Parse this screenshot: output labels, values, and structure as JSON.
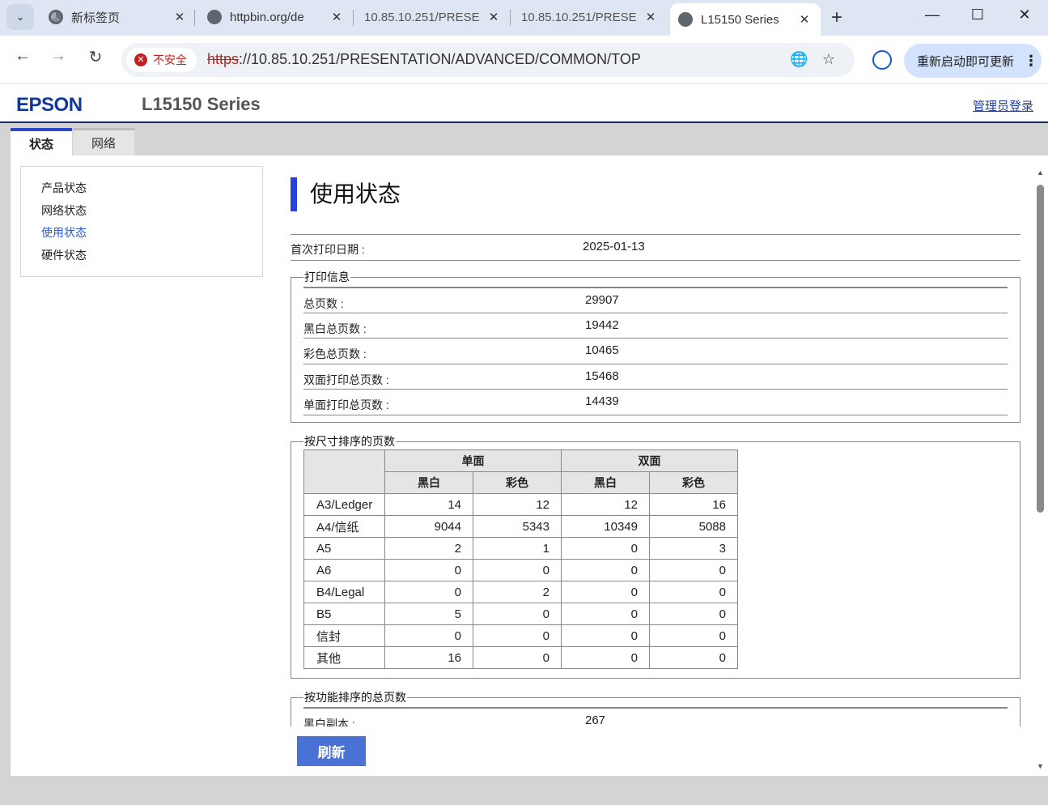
{
  "browser": {
    "tabs": [
      {
        "title": "新标签页",
        "icon": "chrome-icon"
      },
      {
        "title": "httpbin.org/de",
        "icon": "globe-icon"
      },
      {
        "title": "10.85.10.251/PRESE",
        "icon": "none"
      },
      {
        "title": "10.85.10.251/PRESE",
        "icon": "none"
      },
      {
        "title": "L15150 Series",
        "icon": "globe-icon",
        "active": true
      }
    ],
    "security_label": "不安全",
    "url_scheme": "https",
    "url_rest": "://10.85.10.251/PRESENTATION/ADVANCED/COMMON/TOP",
    "update_button": "重新启动即可更新"
  },
  "header": {
    "logo": "EPSON",
    "model": "L15150 Series",
    "admin_link": "管理员登录"
  },
  "tabs": [
    {
      "label": "状态",
      "active": true
    },
    {
      "label": "网络",
      "active": false
    }
  ],
  "sidebar": {
    "items": [
      {
        "label": "产品状态"
      },
      {
        "label": "网络状态"
      },
      {
        "label": "使用状态",
        "current": true
      },
      {
        "label": "硬件状态"
      }
    ]
  },
  "main": {
    "title": "使用状态",
    "first_print": {
      "label": "首次打印日期 :",
      "value": "2025-01-13"
    },
    "print_info": {
      "legend": "打印信息",
      "rows": [
        {
          "label": "总页数 :",
          "value": "29907"
        },
        {
          "label": "黑白总页数 :",
          "value": "19442"
        },
        {
          "label": "彩色总页数 :",
          "value": "10465"
        },
        {
          "label": "双面打印总页数 :",
          "value": "15468"
        },
        {
          "label": "单面打印总页数 :",
          "value": "14439"
        }
      ]
    },
    "by_size": {
      "legend": "按尺寸排序的页数",
      "group_headers": [
        "单面",
        "双面"
      ],
      "sub_headers": [
        "黑白",
        "彩色",
        "黑白",
        "彩色"
      ],
      "rows": [
        {
          "size": "A3/Ledger",
          "values": [
            "14",
            "12",
            "12",
            "16"
          ]
        },
        {
          "size": "A4/信纸",
          "values": [
            "9044",
            "5343",
            "10349",
            "5088"
          ]
        },
        {
          "size": "A5",
          "values": [
            "2",
            "1",
            "0",
            "3"
          ]
        },
        {
          "size": "A6",
          "values": [
            "0",
            "0",
            "0",
            "0"
          ]
        },
        {
          "size": "B4/Legal",
          "values": [
            "0",
            "2",
            "0",
            "0"
          ]
        },
        {
          "size": "B5",
          "values": [
            "5",
            "0",
            "0",
            "0"
          ]
        },
        {
          "size": "信封",
          "values": [
            "0",
            "0",
            "0",
            "0"
          ]
        },
        {
          "size": "其他",
          "values": [
            "16",
            "0",
            "0",
            "0"
          ]
        }
      ]
    },
    "by_function": {
      "legend": "按功能排序的总页数",
      "rows": [
        {
          "label": "黑白副本 :",
          "value": "267"
        }
      ]
    },
    "refresh_button": "刷新"
  }
}
